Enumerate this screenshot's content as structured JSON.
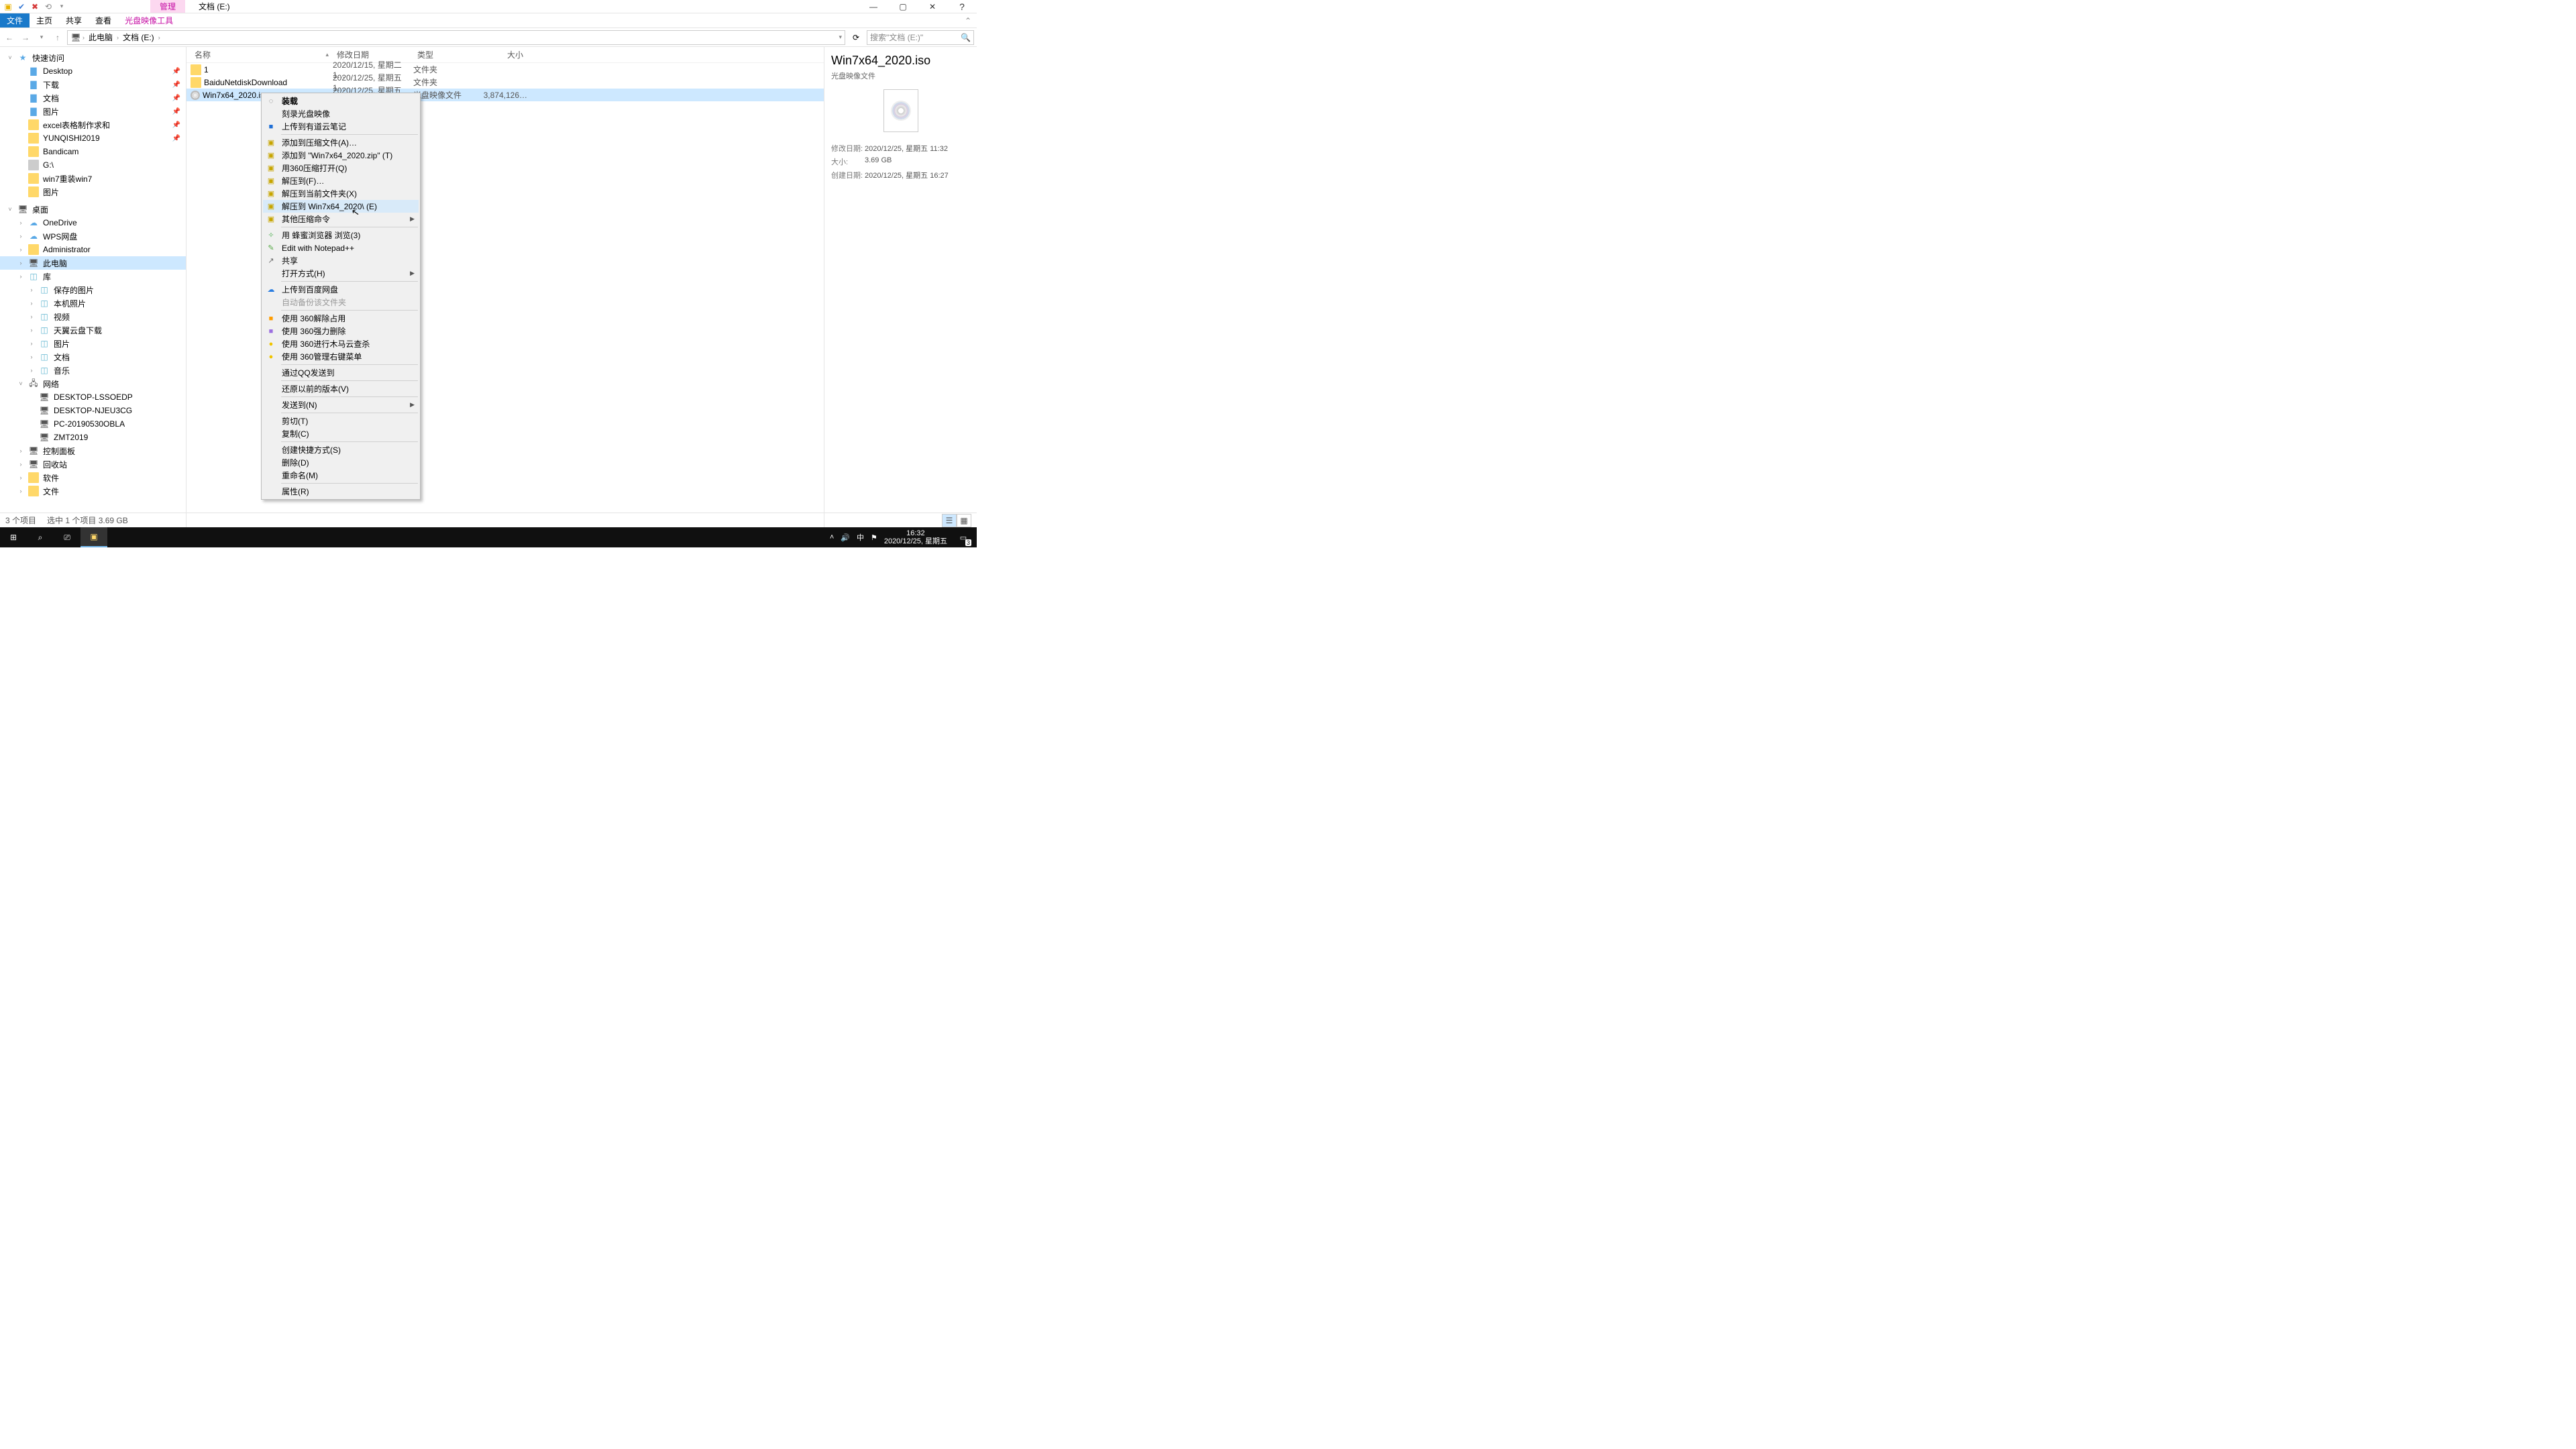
{
  "window": {
    "context_tab": "管理",
    "title": "文档 (E:)",
    "ribbon": {
      "file": "文件",
      "home": "主页",
      "share": "共享",
      "view": "查看",
      "context_tool": "光盘映像工具"
    }
  },
  "breadcrumb": {
    "root": "此电脑",
    "folder": "文档 (E:)"
  },
  "search": {
    "placeholder": "搜索\"文档 (E:)\""
  },
  "columns": {
    "name": "名称",
    "modified": "修改日期",
    "type": "类型",
    "size": "大小"
  },
  "tree": {
    "quick_access": "快速访问",
    "items_qa": [
      {
        "label": "Desktop",
        "pin": true,
        "icon": "blue"
      },
      {
        "label": "下载",
        "pin": true,
        "icon": "blue"
      },
      {
        "label": "文档",
        "pin": true,
        "icon": "blue"
      },
      {
        "label": "图片",
        "pin": true,
        "icon": "blue"
      },
      {
        "label": "excel表格制作求和",
        "pin": true,
        "icon": "folder"
      },
      {
        "label": "YUNQISHI2019",
        "pin": true,
        "icon": "folder"
      },
      {
        "label": "Bandicam",
        "pin": false,
        "icon": "folder"
      },
      {
        "label": "G:\\",
        "pin": false,
        "icon": "drive"
      },
      {
        "label": "win7重装win7",
        "pin": false,
        "icon": "folder"
      },
      {
        "label": "图片",
        "pin": false,
        "icon": "folder"
      }
    ],
    "desktop_root": "桌面",
    "items_d": [
      {
        "label": "OneDrive",
        "icon": "cloud"
      },
      {
        "label": "WPS网盘",
        "icon": "cloud"
      },
      {
        "label": "Administrator",
        "icon": "folder"
      },
      {
        "label": "此电脑",
        "icon": "pc",
        "sel": true
      },
      {
        "label": "库",
        "icon": "lib"
      }
    ],
    "items_lib": [
      {
        "label": "保存的图片"
      },
      {
        "label": "本机照片"
      },
      {
        "label": "视频"
      },
      {
        "label": "天翼云盘下载"
      },
      {
        "label": "图片"
      },
      {
        "label": "文档"
      },
      {
        "label": "音乐"
      }
    ],
    "network": "网络",
    "items_net": [
      {
        "label": "DESKTOP-LSSOEDP"
      },
      {
        "label": "DESKTOP-NJEU3CG"
      },
      {
        "label": "PC-20190530OBLA"
      },
      {
        "label": "ZMT2019"
      }
    ],
    "items_misc": [
      {
        "label": "控制面板",
        "icon": "pc"
      },
      {
        "label": "回收站",
        "icon": "pc"
      },
      {
        "label": "软件",
        "icon": "folder"
      },
      {
        "label": "文件",
        "icon": "folder"
      }
    ]
  },
  "files": [
    {
      "name": "1",
      "mod": "2020/12/15, 星期二 1…",
      "type": "文件夹",
      "size": "",
      "icon": "folder",
      "sel": false
    },
    {
      "name": "BaiduNetdiskDownload",
      "mod": "2020/12/25, 星期五 1…",
      "type": "文件夹",
      "size": "",
      "icon": "folder",
      "sel": false
    },
    {
      "name": "Win7x64_2020.iso",
      "mod": "2020/12/25, 星期五 1…",
      "type": "光盘映像文件",
      "size": "3,874,126…",
      "icon": "iso",
      "sel": true
    }
  ],
  "details": {
    "title": "Win7x64_2020.iso",
    "subtype": "光盘映像文件",
    "mod_k": "修改日期:",
    "mod_v": "2020/12/25, 星期五 11:32",
    "size_k": "大小:",
    "size_v": "3.69 GB",
    "created_k": "创建日期:",
    "created_v": "2020/12/25, 星期五 16:27"
  },
  "status": {
    "count": "3 个项目",
    "selection": "选中 1 个项目  3.69 GB"
  },
  "ctx": [
    {
      "t": "装载",
      "bold": true,
      "ico": "◌"
    },
    {
      "t": "刻录光盘映像"
    },
    {
      "t": "上传到有道云笔记",
      "ico": "■",
      "icocolor": "#1f6fd6"
    },
    {
      "sep": true
    },
    {
      "t": "添加到压缩文件(A)…",
      "ico": "▣",
      "icocolor": "#c7a500"
    },
    {
      "t": "添加到 \"Win7x64_2020.zip\" (T)",
      "ico": "▣",
      "icocolor": "#c7a500"
    },
    {
      "t": "用360压缩打开(Q)",
      "ico": "▣",
      "icocolor": "#c7a500"
    },
    {
      "t": "解压到(F)…",
      "ico": "▣",
      "icocolor": "#c7a500"
    },
    {
      "t": "解压到当前文件夹(X)",
      "ico": "▣",
      "icocolor": "#c7a500"
    },
    {
      "t": "解压到 Win7x64_2020\\ (E)",
      "ico": "▣",
      "icocolor": "#c7a500",
      "hover": true
    },
    {
      "t": "其他压缩命令",
      "ico": "▣",
      "icocolor": "#c7a500",
      "sub": true
    },
    {
      "sep": true
    },
    {
      "t": "用 蜂蜜浏览器 浏览(3)",
      "ico": "✧",
      "icocolor": "#4caf50"
    },
    {
      "t": "Edit with Notepad++",
      "ico": "✎",
      "icocolor": "#56a845"
    },
    {
      "t": "共享",
      "ico": "↗"
    },
    {
      "t": "打开方式(H)",
      "sub": true
    },
    {
      "sep": true
    },
    {
      "t": "上传到百度网盘",
      "ico": "☁",
      "icocolor": "#2a7de1"
    },
    {
      "t": "自动备份该文件夹",
      "disabled": true
    },
    {
      "sep": true
    },
    {
      "t": "使用 360解除占用",
      "ico": "■",
      "icocolor": "#ff9c00"
    },
    {
      "t": "使用 360强力删除",
      "ico": "■",
      "icocolor": "#9c6fe0"
    },
    {
      "t": "使用 360进行木马云查杀",
      "ico": "●",
      "icocolor": "#f0c400"
    },
    {
      "t": "使用 360管理右键菜单",
      "ico": "●",
      "icocolor": "#f0c400"
    },
    {
      "sep": true
    },
    {
      "t": "通过QQ发送到"
    },
    {
      "sep": true
    },
    {
      "t": "还原以前的版本(V)"
    },
    {
      "sep": true
    },
    {
      "t": "发送到(N)",
      "sub": true
    },
    {
      "sep": true
    },
    {
      "t": "剪切(T)"
    },
    {
      "t": "复制(C)"
    },
    {
      "sep": true
    },
    {
      "t": "创建快捷方式(S)"
    },
    {
      "t": "删除(D)"
    },
    {
      "t": "重命名(M)"
    },
    {
      "sep": true
    },
    {
      "t": "属性(R)"
    }
  ],
  "taskbar": {
    "time": "16:32",
    "date": "2020/12/25, 星期五",
    "ime": "中",
    "notif_count": "3"
  }
}
